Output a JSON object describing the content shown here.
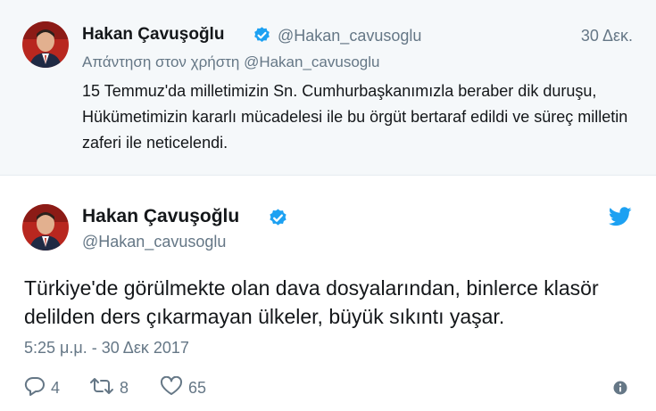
{
  "parent_tweet": {
    "name": "Hakan Çavuşoğlu",
    "handle": "@Hakan_cavusoglu",
    "date": "30 Δεκ.",
    "reply_to": "Απάντηση στον χρήστη @Hakan_cavusoglu",
    "text": "15 Temmuz'da milletimizin Sn. Cumhurbaşkanımızla beraber dik duruşu, Hükümetimizin kararlı mücadelesi ile bu örgüt bertaraf edildi ve süreç milletin zaferi ile neticelendi."
  },
  "main_tweet": {
    "name": "Hakan Çavuşoğlu",
    "handle": "@Hakan_cavusoglu",
    "text": "Türkiye'de görülmekte olan dava dosyalarından, binlerce klasör delilden ders çıkarmayan ülkeler, büyük sıkıntı yaşar.",
    "timestamp": "5:25 μ.μ. - 30 Δεκ 2017",
    "replies": "4",
    "retweets": "8",
    "likes": "65"
  },
  "icons": {
    "verified": "verified-badge-icon",
    "twitter": "twitter-bird-icon",
    "reply": "reply-icon",
    "retweet": "retweet-icon",
    "like": "heart-icon",
    "info": "info-icon"
  },
  "colors": {
    "verified_blue": "#1da1f2",
    "secondary_text": "#657786",
    "parent_background": "#f5f8fa"
  }
}
